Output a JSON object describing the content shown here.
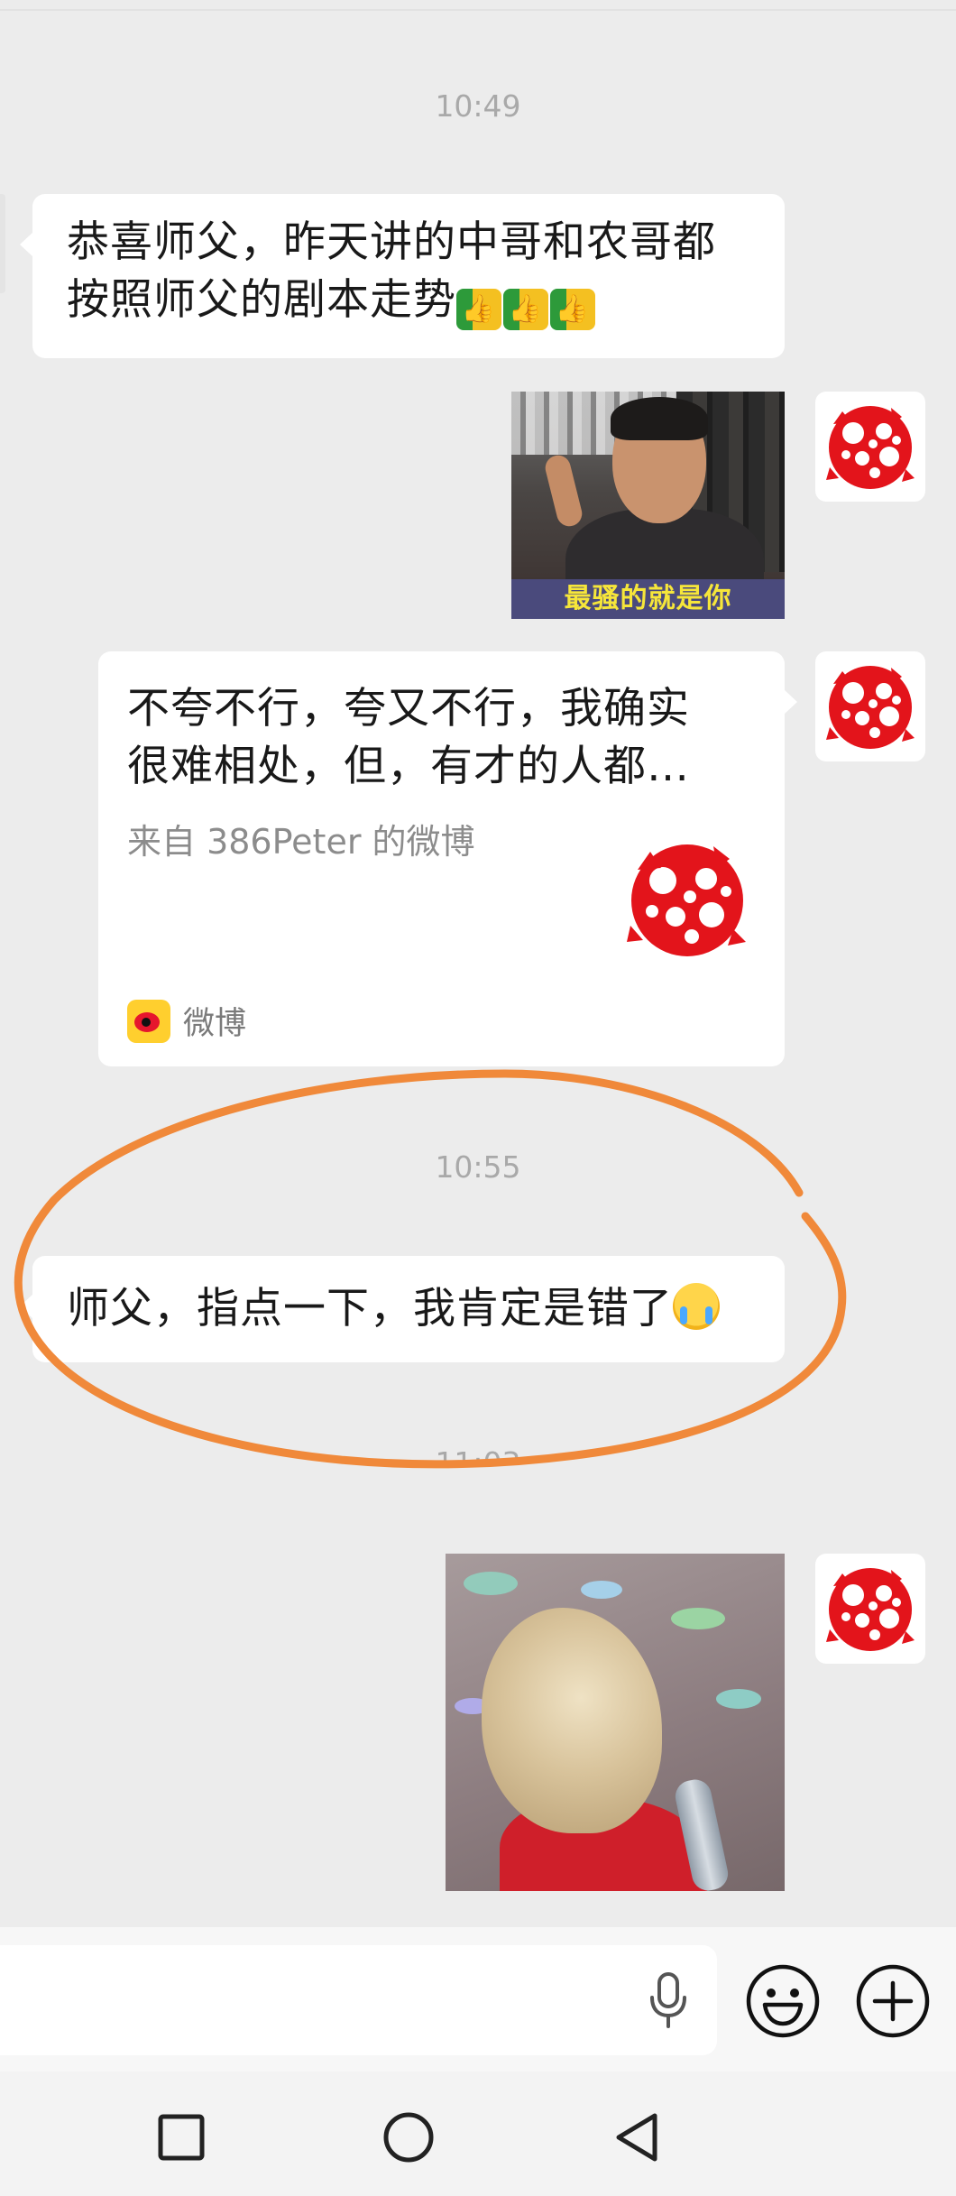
{
  "chat": {
    "timestamp_1": "10:49",
    "msg_1_line_1": "恭喜师父，昨天讲的中哥和农哥都",
    "msg_1_line_2": "按照师父的剧本走势",
    "meme_caption": "最骚的就是你",
    "card": {
      "title_line_1": "不夸不行，夸又不行，我确实",
      "title_line_2": "很难相处，但，有才的人都…",
      "source": "来自 386Peter 的微博",
      "app_label": "微博"
    },
    "timestamp_2": "10:55",
    "msg_2_text": "师父，指点一下，我肯定是错了",
    "timestamp_3": "11:03"
  },
  "icons": {
    "voice": "microphone-icon",
    "emoji": "emoji-icon",
    "more": "plus-icon",
    "nav_recents": "square-icon",
    "nav_home": "circle-icon",
    "nav_back": "triangle-back-icon"
  },
  "colors": {
    "background": "#ececec",
    "bubble": "#ffffff",
    "timestamp": "#a9a9a9",
    "annotation": "#f0893a",
    "avatar_red": "#e3141b"
  }
}
